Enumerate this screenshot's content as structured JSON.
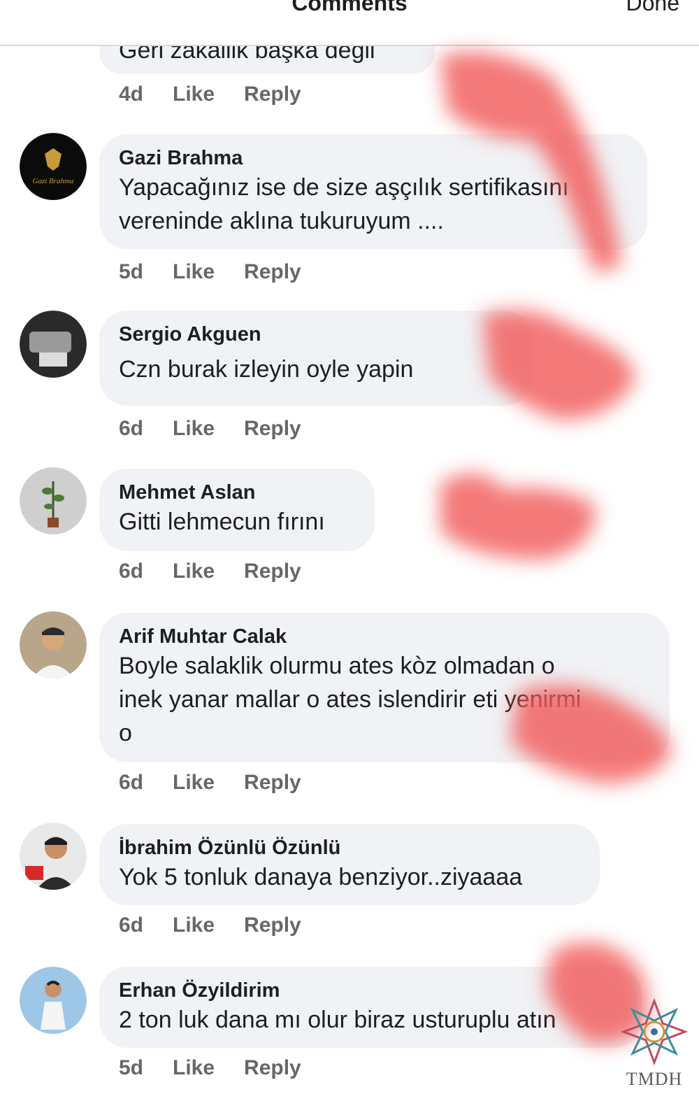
{
  "header": {
    "title": "Comments",
    "done_label": "Done"
  },
  "actions": {
    "like": "Like",
    "reply": "Reply"
  },
  "comments": [
    {
      "author": "",
      "text": "Geri zakallik başka degil",
      "age": "4d"
    },
    {
      "author": "Gazi Brahma",
      "text": "Yapacağınız ise de size aşçılık sertifikasını\nvereninde aklına tukuruyum ....",
      "age": "5d",
      "avatar_text": "Gazi Brahma"
    },
    {
      "author": "Sergio Akguen",
      "text": "Czn burak izleyin oyle yapin",
      "age": "6d"
    },
    {
      "author": "Mehmet Aslan",
      "text": "Gitti lehmecun fırını",
      "age": "6d"
    },
    {
      "author": "Arif Muhtar Calak",
      "text": "Boyle salaklik olurmu ates kòz olmadan o\ninek yanar mallar o ates islendirir eti yenirmi\no",
      "age": "6d"
    },
    {
      "author": "İbrahim Özünlü Özünlü",
      "text": "Yok 5 tonluk danaya benziyor..ziyaaaa",
      "age": "6d"
    },
    {
      "author": "Erhan Özyildirim",
      "text": "2 ton luk dana mı olur biraz usturuplu atın",
      "age": "5d"
    }
  ],
  "watermark": {
    "text": "TMDH"
  },
  "colors": {
    "bubble": "#f0f2f5",
    "meta": "#65676b",
    "redaction": "#f25a5a"
  }
}
